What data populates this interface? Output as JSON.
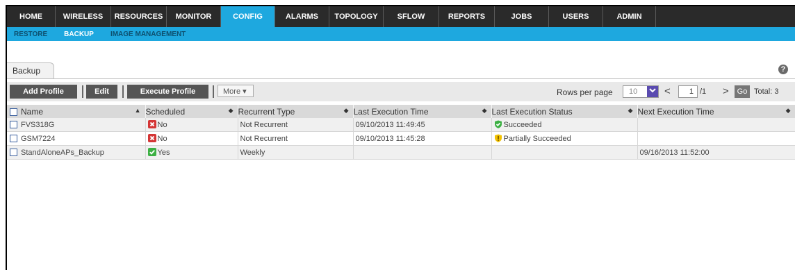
{
  "nav": {
    "tabs": [
      {
        "label": "HOME",
        "active": false
      },
      {
        "label": "WIRELESS",
        "active": false
      },
      {
        "label": "RESOURCES",
        "active": false
      },
      {
        "label": "MONITOR",
        "active": false
      },
      {
        "label": "CONFIG",
        "active": true
      },
      {
        "label": "ALARMS",
        "active": false
      },
      {
        "label": "TOPOLOGY",
        "active": false
      },
      {
        "label": "SFLOW",
        "active": false
      },
      {
        "label": "REPORTS",
        "active": false
      },
      {
        "label": "JOBS",
        "active": false
      },
      {
        "label": "USERS",
        "active": false
      },
      {
        "label": "ADMIN",
        "active": false
      }
    ],
    "active_color": "#1ea8df"
  },
  "subnav": {
    "items": [
      {
        "label": "RESTORE",
        "active": false
      },
      {
        "label": "BACKUP",
        "active": true
      },
      {
        "label": "IMAGE MANAGEMENT",
        "active": false
      }
    ]
  },
  "panel": {
    "tab_label": "Backup",
    "help_icon": "help-icon",
    "help_glyph": "?"
  },
  "toolbar": {
    "add_label": "Add Profile",
    "edit_label": "Edit",
    "execute_label": "Execute Profile",
    "more_label": "More ▾",
    "rows_per_page_label": "Rows per page",
    "rows_per_page_value": "10",
    "prev_glyph": "<",
    "next_glyph": ">",
    "page_value": "1",
    "page_total": "/1",
    "go_label": "Go",
    "total_label": "Total: 3"
  },
  "table": {
    "headers": {
      "name": "Name",
      "scheduled": "Scheduled",
      "recurrent": "Recurrent Type",
      "last_exec": "Last Execution Time",
      "last_status": "Last Execution Status",
      "next_exec": "Next Execution Time"
    },
    "sort_glyphs": {
      "up": "▲",
      "both": "◆"
    },
    "rows": [
      {
        "name": "FVS318G",
        "scheduled": "No",
        "scheduled_icon": "x-icon",
        "recurrent": "Not Recurrent",
        "last_exec": "09/10/2013 11:49:45",
        "last_status": "Succeeded",
        "status_icon": "shield-check-icon",
        "next_exec": ""
      },
      {
        "name": "GSM7224",
        "scheduled": "No",
        "scheduled_icon": "x-icon",
        "recurrent": "Not Recurrent",
        "last_exec": "09/10/2013 11:45:28",
        "last_status": "Partially Succeeded",
        "status_icon": "warning-icon",
        "next_exec": ""
      },
      {
        "name": "StandAloneAPs_Backup",
        "scheduled": "Yes",
        "scheduled_icon": "check-icon",
        "recurrent": "Weekly",
        "last_exec": "",
        "last_status": "",
        "status_icon": "",
        "next_exec": "09/16/2013 11:52:00"
      }
    ]
  },
  "colors": {
    "accent": "#1ea8df",
    "nav_bg": "#2a2a2a",
    "no_red": "#d43535",
    "yes_green": "#3cb043",
    "warn_yellow": "#f2c200"
  }
}
